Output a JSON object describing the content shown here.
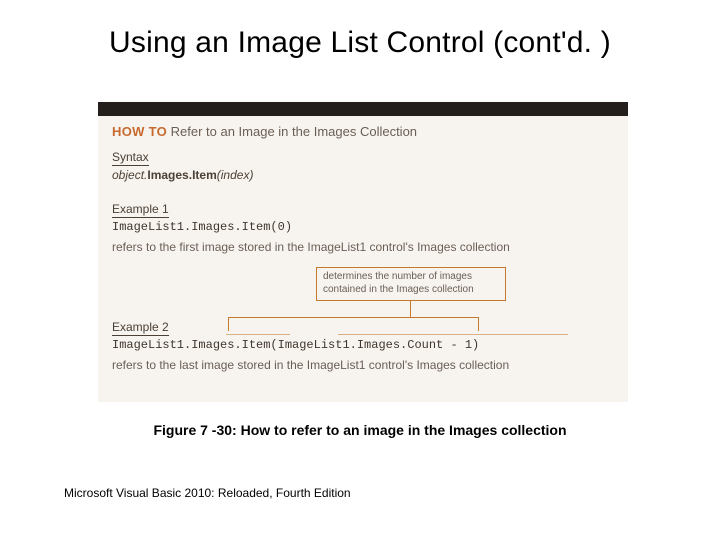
{
  "title": "Using an Image List Control (cont'd. )",
  "howto": {
    "label": "HOW TO",
    "subject": "Refer to an Image in the Images Collection"
  },
  "syntax": {
    "heading": "Syntax",
    "obj": "object",
    "dot1": ".",
    "images": "Images.Item",
    "open": "(",
    "index": "index",
    "close": ")"
  },
  "example1": {
    "heading": "Example 1",
    "code": "ImageList1.Images.Item(0)",
    "desc": "refers to the first image stored in the ImageList1 control's Images collection"
  },
  "callout": {
    "line1": "determines the number of images",
    "line2": "contained in the Images collection"
  },
  "example2": {
    "heading": "Example 2",
    "code": "ImageList1.Images.Item(ImageList1.Images.Count - 1)",
    "desc": "refers to the last image stored in the ImageList1 control's Images collection"
  },
  "caption": "Figure 7 -30: How to refer to an image in the Images collection",
  "footer": "Microsoft Visual Basic 2010: Reloaded, Fourth Edition"
}
